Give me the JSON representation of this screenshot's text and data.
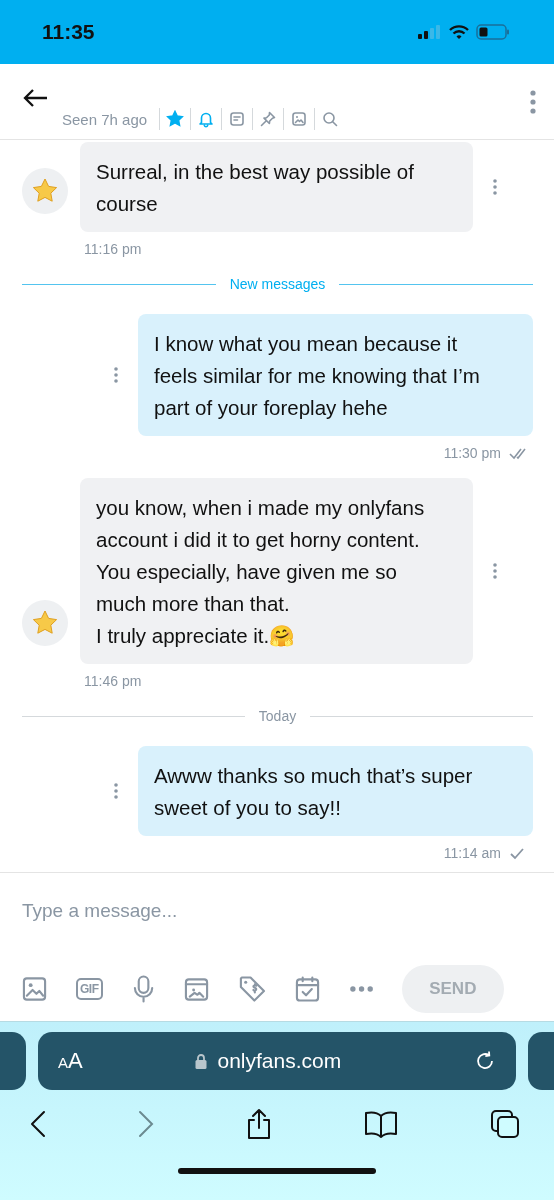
{
  "status_bar": {
    "time": "11:35"
  },
  "header": {
    "seen": "Seen 7h ago",
    "tools": [
      {
        "kind": "star",
        "active": true
      },
      {
        "kind": "bell",
        "active": true
      },
      {
        "kind": "note",
        "active": false
      },
      {
        "kind": "pin",
        "active": false
      },
      {
        "kind": "image",
        "active": false
      },
      {
        "kind": "search",
        "active": false
      }
    ]
  },
  "messages": [
    {
      "kind": "message",
      "outgoing": false,
      "text": "Surreal, in the best way possible of course",
      "time": "11:16 pm"
    },
    {
      "kind": "divider",
      "label": "New messages",
      "accent": true
    },
    {
      "kind": "message",
      "outgoing": true,
      "text": "I know what you mean because it feels similar for me knowing that I’m part of your foreplay hehe",
      "time": "11:30 pm",
      "read": true
    },
    {
      "kind": "message",
      "outgoing": false,
      "text": "you know, when i made my onlyfans account i did it to get horny content.\nYou especially, have given me so much more than that.\nI truly appreciate it.🤗",
      "time": "11:46 pm"
    },
    {
      "kind": "divider",
      "label": "Today",
      "accent": false
    },
    {
      "kind": "message",
      "outgoing": true,
      "text": "Awww thanks so much that’s super sweet of you to say!!",
      "time": "11:14 am",
      "read": false
    }
  ],
  "composer": {
    "placeholder": "Type a message...",
    "gif_label": "GIF",
    "send": {
      "label": "SEND",
      "disabled": true
    }
  },
  "browser": {
    "text_size": "AA",
    "url": "onlyfans.com"
  }
}
